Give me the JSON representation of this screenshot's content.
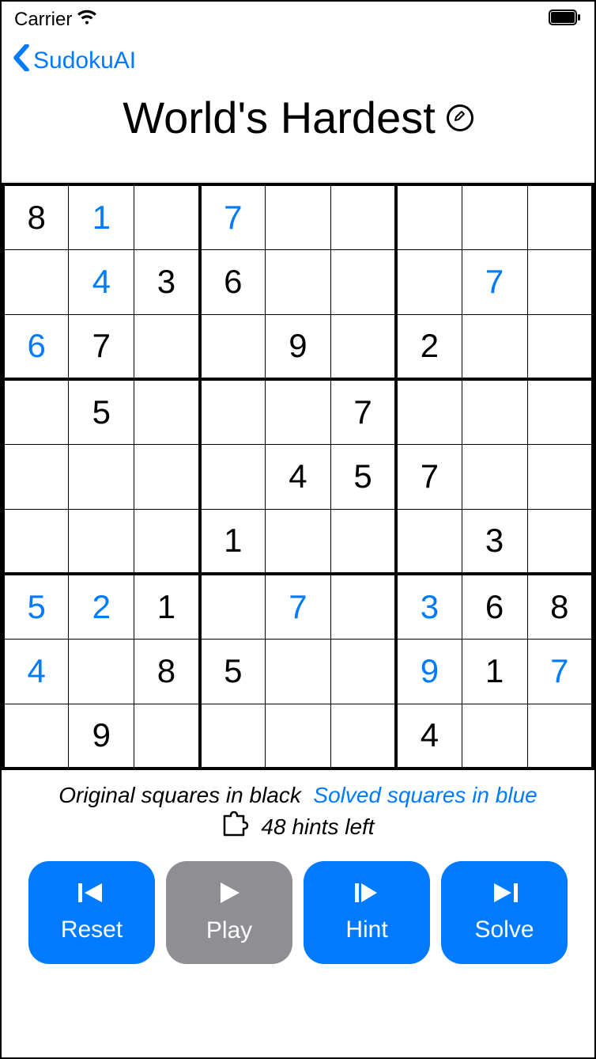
{
  "status": {
    "carrier": "Carrier"
  },
  "nav": {
    "back": "SudokuAI"
  },
  "title": "World's Hardest",
  "legend": {
    "orig": "Original squares in black",
    "solved": "Solved squares in blue"
  },
  "hints": "48 hints left",
  "buttons": {
    "reset": "Reset",
    "play": "Play",
    "hint": "Hint",
    "solve": "Solve"
  },
  "board": [
    [
      {
        "v": "8",
        "t": "o"
      },
      {
        "v": "1",
        "t": "s"
      },
      {
        "v": ""
      },
      {
        "v": "7",
        "t": "s"
      },
      {
        "v": ""
      },
      {
        "v": ""
      },
      {
        "v": ""
      },
      {
        "v": ""
      },
      {
        "v": ""
      }
    ],
    [
      {
        "v": ""
      },
      {
        "v": "4",
        "t": "s"
      },
      {
        "v": "3",
        "t": "o"
      },
      {
        "v": "6",
        "t": "o"
      },
      {
        "v": ""
      },
      {
        "v": ""
      },
      {
        "v": ""
      },
      {
        "v": "7",
        "t": "s"
      },
      {
        "v": ""
      }
    ],
    [
      {
        "v": "6",
        "t": "s"
      },
      {
        "v": "7",
        "t": "o"
      },
      {
        "v": ""
      },
      {
        "v": ""
      },
      {
        "v": "9",
        "t": "o"
      },
      {
        "v": ""
      },
      {
        "v": "2",
        "t": "o"
      },
      {
        "v": ""
      },
      {
        "v": ""
      }
    ],
    [
      {
        "v": ""
      },
      {
        "v": "5",
        "t": "o"
      },
      {
        "v": ""
      },
      {
        "v": ""
      },
      {
        "v": ""
      },
      {
        "v": "7",
        "t": "o"
      },
      {
        "v": ""
      },
      {
        "v": ""
      },
      {
        "v": ""
      }
    ],
    [
      {
        "v": ""
      },
      {
        "v": ""
      },
      {
        "v": ""
      },
      {
        "v": ""
      },
      {
        "v": "4",
        "t": "o"
      },
      {
        "v": "5",
        "t": "o"
      },
      {
        "v": "7",
        "t": "o"
      },
      {
        "v": ""
      },
      {
        "v": ""
      }
    ],
    [
      {
        "v": ""
      },
      {
        "v": ""
      },
      {
        "v": ""
      },
      {
        "v": "1",
        "t": "o"
      },
      {
        "v": ""
      },
      {
        "v": ""
      },
      {
        "v": ""
      },
      {
        "v": "3",
        "t": "o"
      },
      {
        "v": ""
      }
    ],
    [
      {
        "v": "5",
        "t": "s"
      },
      {
        "v": "2",
        "t": "s"
      },
      {
        "v": "1",
        "t": "o"
      },
      {
        "v": ""
      },
      {
        "v": "7",
        "t": "s"
      },
      {
        "v": ""
      },
      {
        "v": "3",
        "t": "s"
      },
      {
        "v": "6",
        "t": "o"
      },
      {
        "v": "8",
        "t": "o"
      }
    ],
    [
      {
        "v": "4",
        "t": "s"
      },
      {
        "v": ""
      },
      {
        "v": "8",
        "t": "o"
      },
      {
        "v": "5",
        "t": "o"
      },
      {
        "v": ""
      },
      {
        "v": ""
      },
      {
        "v": "9",
        "t": "s"
      },
      {
        "v": "1",
        "t": "o"
      },
      {
        "v": "7",
        "t": "s"
      }
    ],
    [
      {
        "v": ""
      },
      {
        "v": "9",
        "t": "o"
      },
      {
        "v": ""
      },
      {
        "v": ""
      },
      {
        "v": ""
      },
      {
        "v": ""
      },
      {
        "v": "4",
        "t": "o"
      },
      {
        "v": ""
      },
      {
        "v": ""
      }
    ]
  ]
}
